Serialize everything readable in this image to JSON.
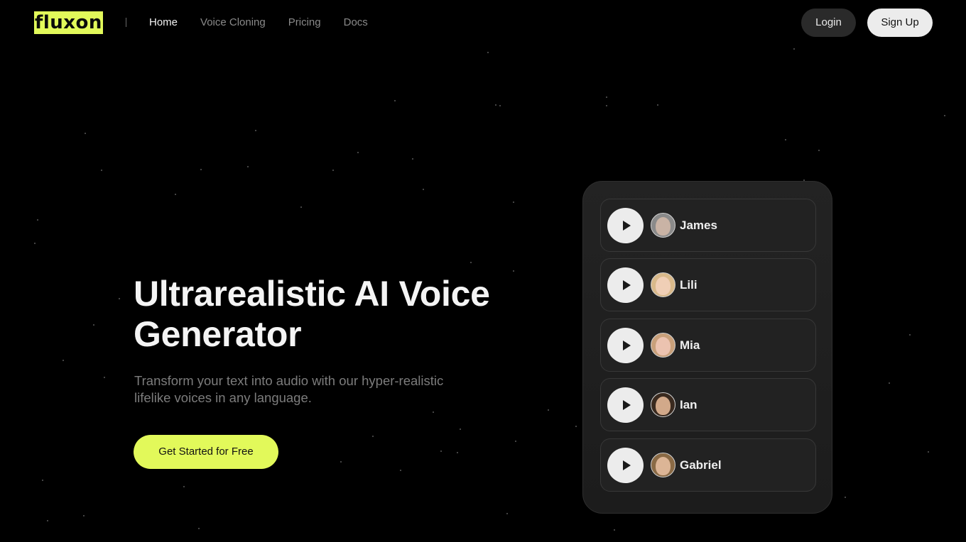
{
  "brand": {
    "logo_text": "fluxon",
    "accent_color": "#e2f95a"
  },
  "nav": {
    "links": [
      {
        "label": "Home",
        "active": true
      },
      {
        "label": "Voice Cloning",
        "active": false
      },
      {
        "label": "Pricing",
        "active": false
      },
      {
        "label": "Docs",
        "active": false
      }
    ]
  },
  "auth": {
    "login_label": "Login",
    "signup_label": "Sign Up"
  },
  "hero": {
    "title_line1": "Ultrarealistic AI Voice",
    "title_line2": "Generator",
    "subtitle_line1": "Transform your text into audio with our hyper-realistic",
    "subtitle_line2": "lifelike voices in any language.",
    "cta_label": "Get Started for Free"
  },
  "voices": [
    {
      "name": "James",
      "icon": "play-icon",
      "avatar": "older-man-portrait"
    },
    {
      "name": "Lili",
      "icon": "play-icon",
      "avatar": "blonde-woman-portrait"
    },
    {
      "name": "Mia",
      "icon": "play-icon",
      "avatar": "woman-portrait"
    },
    {
      "name": "Ian",
      "icon": "play-icon",
      "avatar": "curly-haired-man-glasses-portrait"
    },
    {
      "name": "Gabriel",
      "icon": "play-icon",
      "avatar": "young-man-portrait"
    }
  ]
}
